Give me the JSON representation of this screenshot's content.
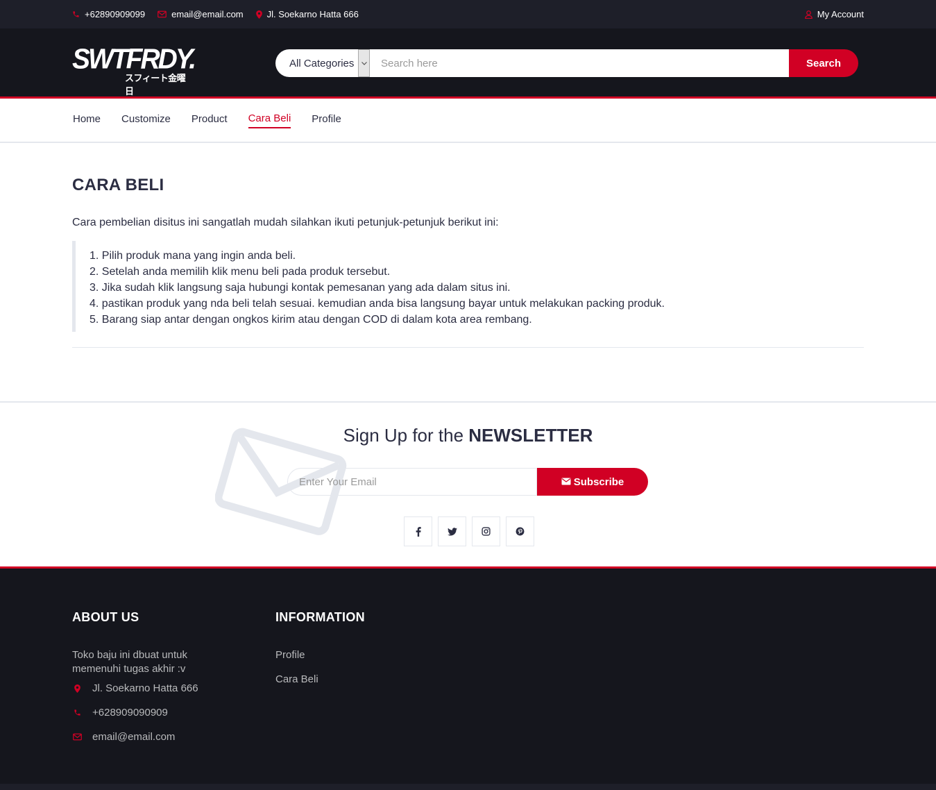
{
  "topbar": {
    "phone": "+62890909099",
    "email": "email@email.com",
    "address": "Jl. Soekarno Hatta 666",
    "account": "My Account"
  },
  "header": {
    "logo_text": "SWTFRDY.",
    "logo_sub": "スフィート金曜日",
    "category": "All Categories",
    "search_placeholder": "Search here",
    "search_button": "Search"
  },
  "nav": {
    "items": [
      "Home",
      "Customize",
      "Product",
      "Cara Beli",
      "Profile"
    ],
    "active": "Cara Beli"
  },
  "main": {
    "title": "CARA BELI",
    "intro": "Cara pembelian disitus ini sangatlah mudah silahkan ikuti petunjuk-petunjuk berikut ini:",
    "steps": [
      "1. Pilih produk mana yang ingin anda beli.",
      "2. Setelah anda memilih klik menu beli pada produk tersebut.",
      "3. Jika sudah klik langsung saja hubungi kontak pemesanan yang ada dalam situs ini.",
      "4. pastikan produk yang nda beli telah sesuai. kemudian anda bisa langsung bayar untuk melakukan packing produk.",
      "5. Barang siap antar dengan ongkos kirim atau dengan COD di dalam kota area rembang."
    ]
  },
  "newsletter": {
    "title_prefix": "Sign Up for the ",
    "title_bold": "NEWSLETTER",
    "email_placeholder": "Enter Your Email",
    "subscribe": "Subscribe",
    "socials": [
      "facebook-icon",
      "twitter-icon",
      "instagram-icon",
      "pinterest-icon"
    ]
  },
  "footer": {
    "about_title": "ABOUT US",
    "about_text": "Toko baju ini dbuat untuk memenuhi tugas akhir :v",
    "address": "Jl. Soekarno Hatta 666",
    "phone": "+628909090909",
    "email": "email@email.com",
    "info_title": "INFORMATION",
    "info_links": [
      "Profile",
      "Cara Beli"
    ]
  },
  "colors": {
    "accent": "#d10024",
    "dark": "#15161d",
    "topbar": "#1e1f29",
    "text": "#2b2d42"
  }
}
